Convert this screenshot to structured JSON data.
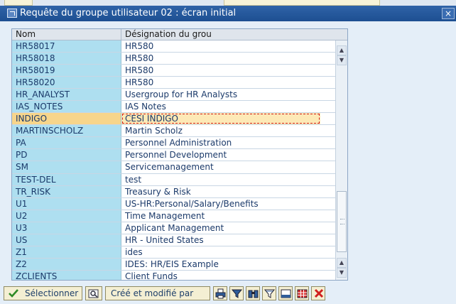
{
  "window": {
    "title": "Requête du groupe utilisateur 02 : écran initial",
    "close_label": "×"
  },
  "table": {
    "columns": [
      "Nom",
      "Désignation du grou"
    ],
    "rows": [
      {
        "name": "HR58017",
        "designation": "HR580"
      },
      {
        "name": "HR58018",
        "designation": "HR580"
      },
      {
        "name": "HR58019",
        "designation": "HR580"
      },
      {
        "name": "HR58020",
        "designation": "HR580"
      },
      {
        "name": "HR_ANALYST",
        "designation": "Usergroup for HR Analysts"
      },
      {
        "name": "IAS_NOTES",
        "designation": "IAS Notes"
      },
      {
        "name": "INDIGO",
        "designation": "CESI INDIGO",
        "selected": true
      },
      {
        "name": "MARTINSCHOLZ",
        "designation": "Martin Scholz"
      },
      {
        "name": "PA",
        "designation": "Personnel Administration"
      },
      {
        "name": "PD",
        "designation": "Personnel Development"
      },
      {
        "name": "SM",
        "designation": "Servicemanagement"
      },
      {
        "name": "TEST-DEL",
        "designation": "test"
      },
      {
        "name": "TR_RISK",
        "designation": "Treasury & Risk"
      },
      {
        "name": "U1",
        "designation": "US-HR:Personal/Salary/Benefits"
      },
      {
        "name": "U2",
        "designation": "Time Management"
      },
      {
        "name": "U3",
        "designation": "Applicant Management"
      },
      {
        "name": "US",
        "designation": "HR - United States"
      },
      {
        "name": "Z1",
        "designation": "ides"
      },
      {
        "name": "Z2",
        "designation": "IDES: HR/EIS Example"
      },
      {
        "name": "ZCLIENTS",
        "designation": "Client Funds"
      }
    ]
  },
  "toolbar": {
    "select_label": "Sélectionner",
    "created_modified_label": "Créé et modifié par",
    "icons": [
      "checkmark-icon",
      "zoom-icon",
      "print-icon",
      "filter-icon",
      "find-icon",
      "filter-settings-icon",
      "layout-icon",
      "table-icon",
      "cancel-icon"
    ]
  },
  "colors": {
    "title_bar": "#1d4f92",
    "key_column": "#aedff0",
    "selected_row": "#f7d58b",
    "button_face": "#f4efd3",
    "cancel_red": "#d02020"
  }
}
